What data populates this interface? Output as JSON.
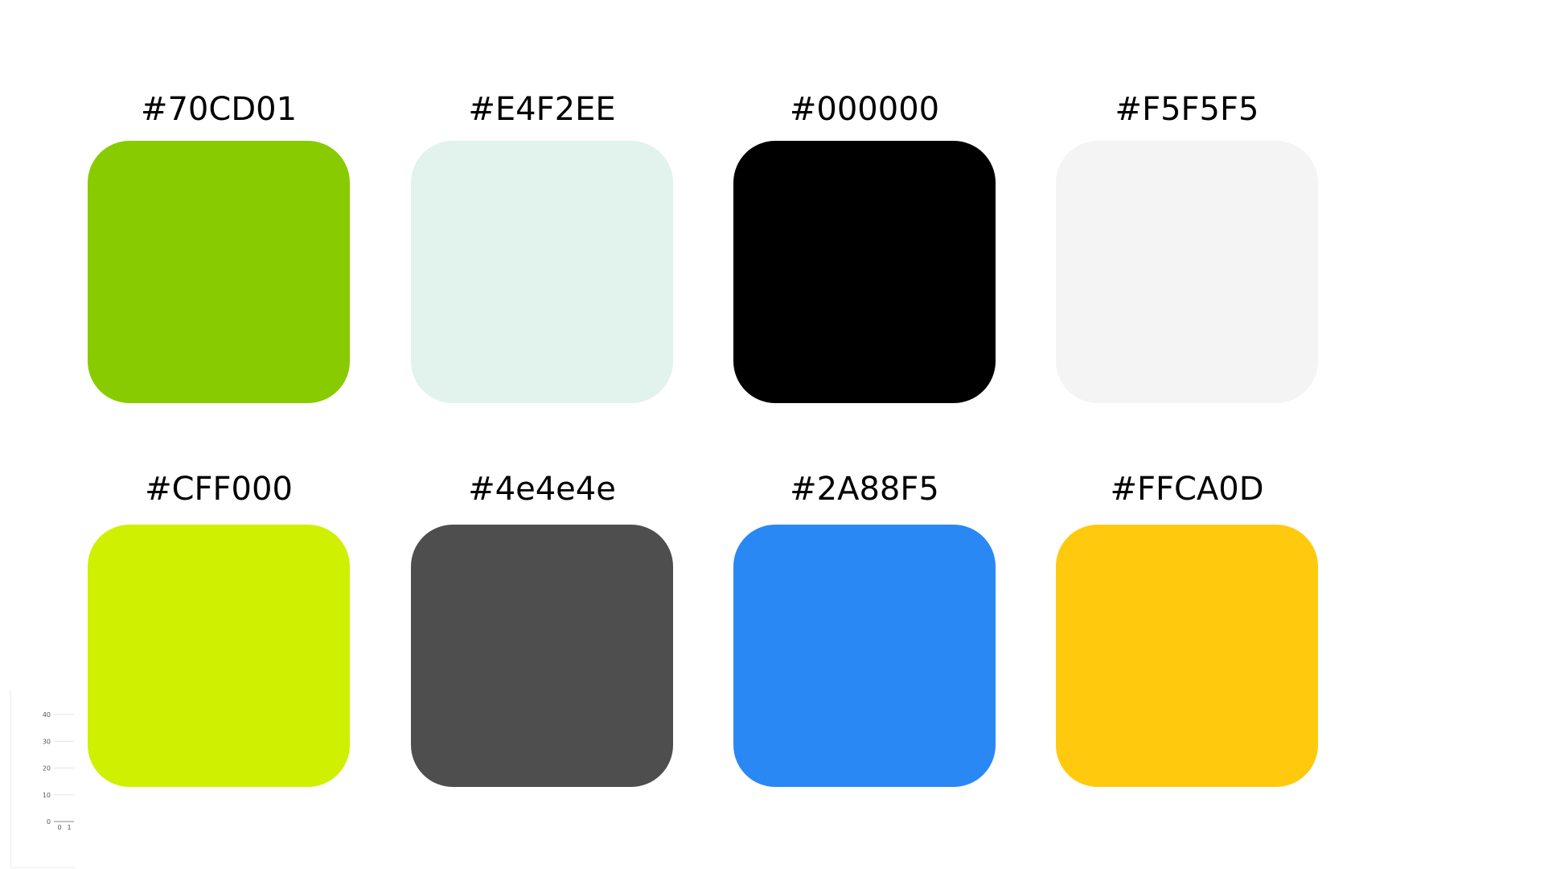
{
  "swatches": [
    {
      "label": "#70CD01",
      "color": "#88CB00"
    },
    {
      "label": "#E4F2EE",
      "color": "#E2F2ED"
    },
    {
      "label": "#000000",
      "color": "#000000"
    },
    {
      "label": "#F5F5F5",
      "color": "#F4F4F4"
    },
    {
      "label": "#CFF000",
      "color": "#CFF000"
    },
    {
      "label": "#4e4e4e",
      "color": "#4E4E4E"
    },
    {
      "label": "#2A88F5",
      "color": "#2A88F5"
    },
    {
      "label": "#FFCA0D",
      "color": "#FFCA0D"
    }
  ],
  "chart_data": {
    "type": "line",
    "x_ticks": [
      "0",
      "1"
    ],
    "y_ticks": [
      "0",
      "10",
      "20",
      "30",
      "40"
    ],
    "ylim": [
      0,
      40
    ],
    "grid": true
  }
}
